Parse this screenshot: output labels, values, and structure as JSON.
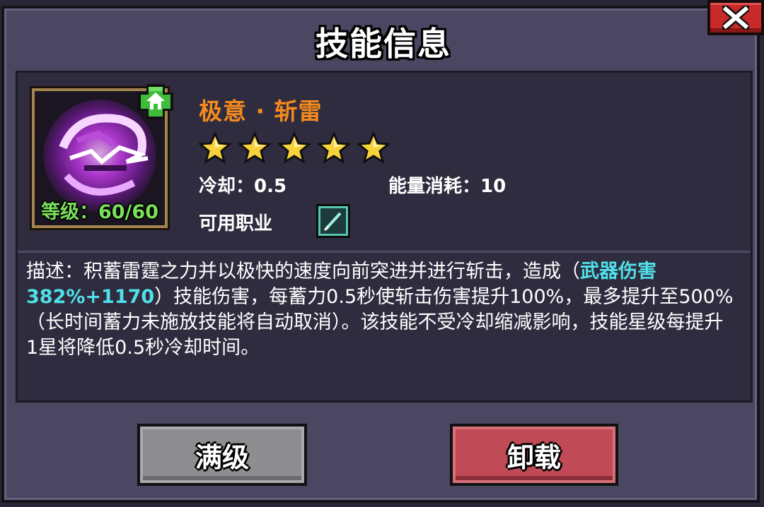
{
  "dialog": {
    "title": "技能信息",
    "close_icon": "close-x-icon"
  },
  "skill": {
    "icon": "lightning-slash-icon",
    "level_text": "等级：60/60",
    "upgrade_badge_icon": "home-upgrade-icon",
    "name": "极意 · 斩雷",
    "stars": 5,
    "cooldown_text": "冷却：0.5",
    "energy_text": "能量消耗：10",
    "class_label": "可用职业",
    "class_icon": "sword-class-icon"
  },
  "description": {
    "prefix": "描述：积蓄雷霆之力并以极快的速度向前突进并进行斩击，造成（",
    "highlight": "武器伤害382%+1170",
    "suffix": "）技能伤害，每蓄力0.5秒使斩击伤害提升100%，最多提升至500%（长时间蓄力未施放技能将自动取消）。该技能不受冷却缩减影响，技能星级每提升1星将降低0.5秒冷却时间。"
  },
  "buttons": {
    "max_label": "满级",
    "unload_label": "卸载"
  },
  "colors": {
    "skill_name": "#f58a1e",
    "highlight": "#4fe0e8",
    "level": "#7be05a",
    "unload_button": "#c04a55",
    "max_button": "#8e8e91"
  }
}
